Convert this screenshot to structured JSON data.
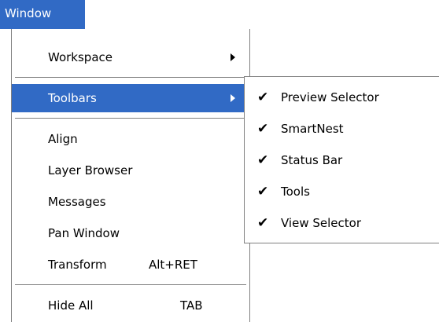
{
  "menubar": {
    "window_label": "Window"
  },
  "menu": {
    "items": [
      {
        "label": "Workspace",
        "has_submenu": true
      },
      {
        "label": "Toolbars",
        "has_submenu": true,
        "highlighted": true
      },
      {
        "label": "Align"
      },
      {
        "label": "Layer Browser"
      },
      {
        "label": "Messages"
      },
      {
        "label": "Pan Window"
      },
      {
        "label": "Transform",
        "shortcut": "Alt+RET"
      },
      {
        "label": "Hide All",
        "shortcut": "TAB"
      }
    ]
  },
  "submenu": {
    "check_glyph": "✔",
    "items": [
      {
        "label": "Preview Selector",
        "checked": true
      },
      {
        "label": "SmartNest",
        "checked": true
      },
      {
        "label": "Status Bar",
        "checked": true
      },
      {
        "label": "Tools",
        "checked": true
      },
      {
        "label": "View Selector",
        "checked": true
      }
    ]
  },
  "colors": {
    "highlight": "#316ac5",
    "separator": "#808080"
  }
}
